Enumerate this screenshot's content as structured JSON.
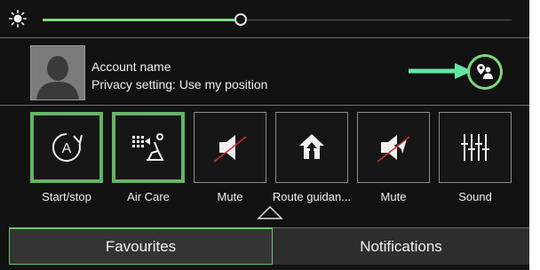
{
  "brightness": {
    "level": 0.42,
    "icon": "sun-icon"
  },
  "account": {
    "name": "Account name",
    "privacy": "Privacy setting: Use my position",
    "location_button_icon": "user-location-icon"
  },
  "tiles": [
    {
      "label": "Start/stop",
      "icon": "auto-start-stop-icon",
      "active": true
    },
    {
      "label": "Air Care",
      "icon": "air-care-icon",
      "active": true
    },
    {
      "label": "Mute",
      "icon": "speaker-mute-icon",
      "active": false
    },
    {
      "label": "Route guidan...",
      "icon": "route-guidance-icon",
      "active": false
    },
    {
      "label": "Mute",
      "icon": "navigation-mute-icon",
      "active": false
    },
    {
      "label": "Sound",
      "icon": "equalizer-icon",
      "active": false
    }
  ],
  "tabs": {
    "favourites": "Favourites",
    "notifications": "Notifications"
  },
  "colors": {
    "accent": "#7ed87e",
    "background": "#121212",
    "tile_border": "#8c8c8c"
  }
}
